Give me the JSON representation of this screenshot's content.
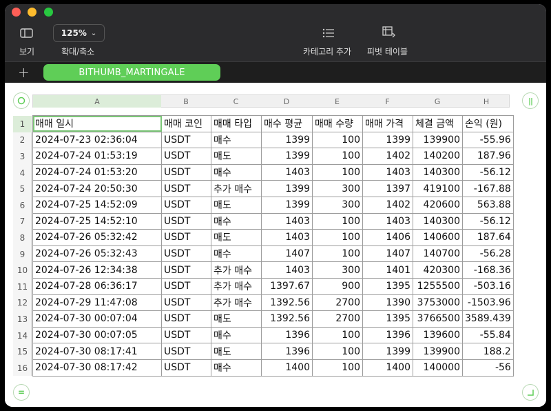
{
  "toolbar": {
    "view_label": "보기",
    "zoom_value": "125%",
    "zoom_label": "확대/축소",
    "category_label": "카테고리 추가",
    "pivot_label": "피벗 테이블"
  },
  "sheet": {
    "tab_name": "BITHUMB_MARTINGALE"
  },
  "columns": [
    "A",
    "B",
    "C",
    "D",
    "E",
    "F",
    "G",
    "H"
  ],
  "rows": [
    "1",
    "2",
    "3",
    "4",
    "5",
    "6",
    "7",
    "8",
    "9",
    "10",
    "11",
    "12",
    "13",
    "14",
    "15",
    "16"
  ],
  "table": {
    "headers": [
      "매매 일시",
      "매매 코인",
      "매매 타입",
      "매수 평균",
      "매매 수량",
      "매매 가격",
      "체결 금액",
      "손익 (원)"
    ],
    "data": [
      [
        "2024-07-23 02:36:04",
        "USDT",
        "매수",
        "1399",
        "100",
        "1399",
        "139900",
        "-55.96"
      ],
      [
        "2024-07-24 01:53:19",
        "USDT",
        "매도",
        "1399",
        "100",
        "1402",
        "140200",
        "187.96"
      ],
      [
        "2024-07-24 01:53:20",
        "USDT",
        "매수",
        "1403",
        "100",
        "1403",
        "140300",
        "-56.12"
      ],
      [
        "2024-07-24 20:50:30",
        "USDT",
        "추가 매수",
        "1399",
        "300",
        "1397",
        "419100",
        "-167.88"
      ],
      [
        "2024-07-25 14:52:09",
        "USDT",
        "매도",
        "1399",
        "300",
        "1402",
        "420600",
        "563.88"
      ],
      [
        "2024-07-25 14:52:10",
        "USDT",
        "매수",
        "1403",
        "100",
        "1403",
        "140300",
        "-56.12"
      ],
      [
        "2024-07-26 05:32:42",
        "USDT",
        "매도",
        "1403",
        "100",
        "1406",
        "140600",
        "187.64"
      ],
      [
        "2024-07-26 05:32:43",
        "USDT",
        "매수",
        "1407",
        "100",
        "1407",
        "140700",
        "-56.28"
      ],
      [
        "2024-07-26 12:34:38",
        "USDT",
        "추가 매수",
        "1403",
        "300",
        "1401",
        "420300",
        "-168.36"
      ],
      [
        "2024-07-28 06:36:17",
        "USDT",
        "추가 매수",
        "1397.67",
        "900",
        "1395",
        "1255500",
        "-503.16"
      ],
      [
        "2024-07-29 11:47:08",
        "USDT",
        "추가 매수",
        "1392.56",
        "2700",
        "1390",
        "3753000",
        "-1503.96"
      ],
      [
        "2024-07-30 00:07:04",
        "USDT",
        "매도",
        "1392.56",
        "2700",
        "1395",
        "3766500",
        "3589.439"
      ],
      [
        "2024-07-30 00:07:05",
        "USDT",
        "매수",
        "1396",
        "100",
        "1396",
        "139600",
        "-55.84"
      ],
      [
        "2024-07-30 08:17:41",
        "USDT",
        "매도",
        "1396",
        "100",
        "1399",
        "139900",
        "188.2"
      ],
      [
        "2024-07-30 08:17:42",
        "USDT",
        "매수",
        "1400",
        "100",
        "1400",
        "140000",
        "-56"
      ]
    ]
  },
  "colors": {
    "accent": "#5fce57",
    "titlebar": "#2b2b2d",
    "tabbar": "#1e1e1e"
  }
}
